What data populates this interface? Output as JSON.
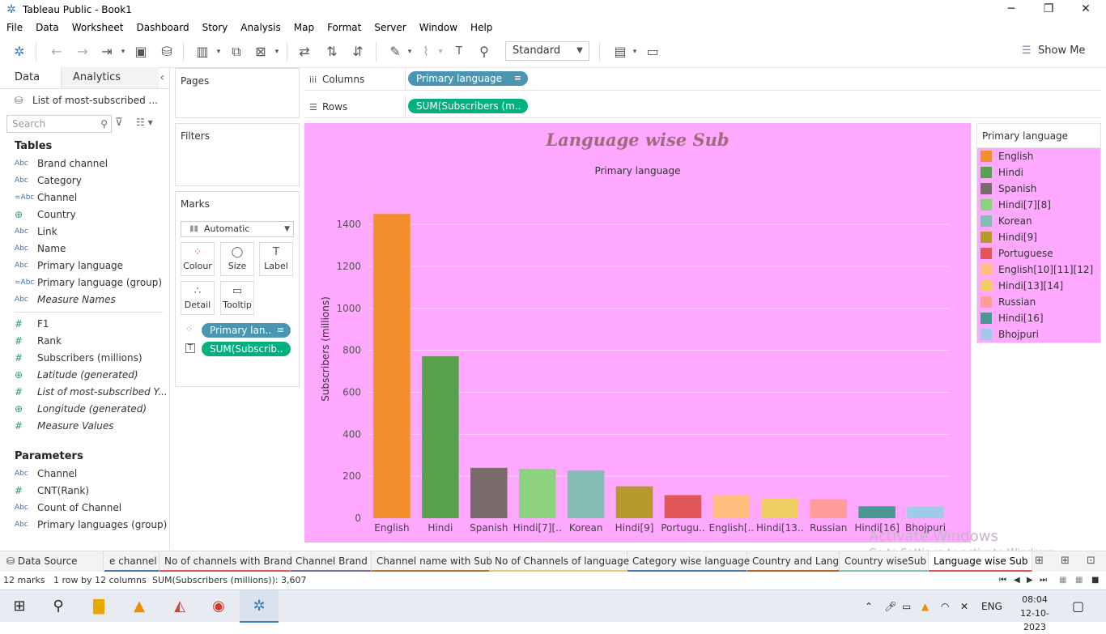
{
  "window": {
    "title": "Tableau Public - Book1",
    "min": "─",
    "max": "❐",
    "close": "✕"
  },
  "menu": [
    "File",
    "Data",
    "Worksheet",
    "Dashboard",
    "Story",
    "Analysis",
    "Map",
    "Format",
    "Server",
    "Window",
    "Help"
  ],
  "toolbar": {
    "fit": "Standard",
    "show_me": "Show Me"
  },
  "data_pane": {
    "tab_data": "Data",
    "tab_analytics": "Analytics",
    "datasource": "List of most-subscribed ...",
    "search_placeholder": "Search",
    "tables_header": "Tables",
    "dimensions": [
      {
        "type": "Abc",
        "name": "Brand channel"
      },
      {
        "type": "Abc",
        "name": "Category"
      },
      {
        "type": "=Abc",
        "name": "Channel"
      },
      {
        "type": "⊕",
        "name": "Country"
      },
      {
        "type": "Abc",
        "name": "Link"
      },
      {
        "type": "Abc",
        "name": "Name"
      },
      {
        "type": "Abc",
        "name": "Primary language"
      },
      {
        "type": "=Abc",
        "name": "Primary language (group)"
      },
      {
        "type": "Abc",
        "name": "Measure Names"
      }
    ],
    "measures": [
      {
        "type": "#",
        "name": "F1"
      },
      {
        "type": "#",
        "name": "Rank"
      },
      {
        "type": "#",
        "name": "Subscribers (millions)"
      },
      {
        "type": "⊕",
        "name": "Latitude (generated)"
      },
      {
        "type": "#",
        "name": "List of most-subscribed Y..."
      },
      {
        "type": "⊕",
        "name": "Longitude (generated)"
      },
      {
        "type": "#",
        "name": "Measure Values"
      }
    ],
    "parameters_header": "Parameters",
    "parameters": [
      {
        "type": "Abc",
        "name": "Channel"
      },
      {
        "type": "#",
        "name": "CNT(Rank)"
      },
      {
        "type": "Abc",
        "name": "Count of Channel"
      },
      {
        "type": "Abc",
        "name": "Primary languages (group)"
      }
    ]
  },
  "shelves": {
    "pages": "Pages",
    "filters": "Filters",
    "marks": "Marks",
    "mark_type": "Automatic",
    "mark_buttons": [
      "Colour",
      "Size",
      "Label",
      "Detail",
      "Tooltip"
    ],
    "mark_pill_color": "Primary lan..",
    "mark_pill_label": "SUM(Subscrib..",
    "columns_label": "Columns",
    "rows_label": "Rows",
    "columns_pill": "Primary language",
    "rows_pill": "SUM(Subscribers (m.."
  },
  "chart_data": {
    "type": "bar",
    "title": "Language wise Sub",
    "column_header": "Primary language",
    "ylabel": "Subscribers (millions)",
    "ylim": [
      0,
      1500
    ],
    "yticks": [
      0,
      200,
      400,
      600,
      800,
      1000,
      1200,
      1400
    ],
    "grid": true,
    "categories": [
      "English",
      "Hindi",
      "Spanish",
      "Hindi[7][8]",
      "Korean",
      "Hindi[9]",
      "Portuguese",
      "English[10][11][12]",
      "Hindi[13][14]",
      "Russian",
      "Hindi[16]",
      "Bhojpuri"
    ],
    "tick_labels": [
      "English",
      "Hindi",
      "Spanish",
      "Hindi[7][..",
      "Korean",
      "Hindi[9]",
      "Portugu..",
      "English[..",
      "Hindi[13..",
      "Russian",
      "Hindi[16]",
      "Bhojpuri"
    ],
    "values": [
      1450,
      772,
      240,
      235,
      228,
      152,
      110,
      108,
      94,
      90,
      57,
      55
    ],
    "colors": [
      "#f28e2b",
      "#59a14f",
      "#7a6b6b",
      "#8cd17d",
      "#86bcb6",
      "#b6992d",
      "#e15759",
      "#ffbe7d",
      "#f1ce63",
      "#ff9d9a",
      "#499894",
      "#a0cbe8"
    ]
  },
  "legend": {
    "title": "Primary language"
  },
  "sheet_tabs": {
    "datasource": "Data Source",
    "tabs": [
      {
        "label": "e channel",
        "color": "#4e79a7"
      },
      {
        "label": "No of channels with Brand",
        "color": "#e15759"
      },
      {
        "label": "Channel Brand",
        "color": "#7a6b9b"
      },
      {
        "label": "Channel name with Sub",
        "color": "#b07a2a"
      },
      {
        "label": "No of Channels of language",
        "color": "#e6c774"
      },
      {
        "label": "Category wise language",
        "color": "#4e79a7"
      },
      {
        "label": "Country and Lang",
        "color": "#b0642a"
      },
      {
        "label": "Country wiseSub",
        "color": "#86bcb6"
      },
      {
        "label": "Language wise Sub",
        "color": "#e15759"
      }
    ]
  },
  "status": {
    "marks": "12 marks",
    "grid": "1 row by 12 columns",
    "sum": "SUM(Subscribers (millions)): 3,607"
  },
  "watermark": {
    "line1": "Activate Windows",
    "line2": "Go to Settings to activate Windows."
  },
  "taskbar": {
    "lang": "ENG",
    "time": "08:04",
    "date": "12-10-2023"
  }
}
